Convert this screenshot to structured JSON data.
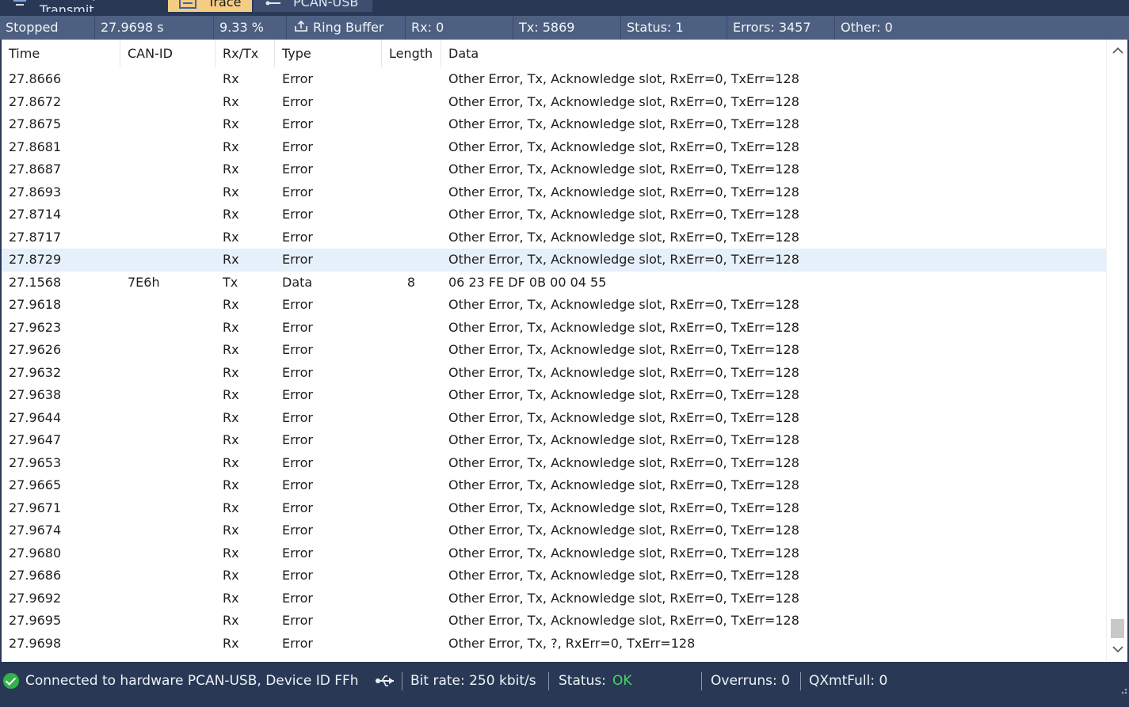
{
  "tabs": [
    {
      "label": "Receive / Transmit",
      "icon": "receive-transmit-icon"
    },
    {
      "label": "Trace",
      "icon": "trace-icon"
    },
    {
      "label": "PCAN-USB",
      "icon": "usb-icon"
    }
  ],
  "trace_status": {
    "state": "Stopped",
    "time": "27.9698 s",
    "buffer_percent": "9.33 %",
    "buffer_mode": "Ring Buffer",
    "rx": "Rx: 0",
    "tx": "Tx: 5869",
    "status": "Status: 1",
    "errors": "Errors: 3457",
    "other": "Other: 0"
  },
  "columns": [
    "Time",
    "CAN-ID",
    "Rx/Tx",
    "Type",
    "Length",
    "Data"
  ],
  "rows": [
    {
      "time": "27.8666",
      "id": "",
      "dir": "Rx",
      "type": "Error",
      "len": "",
      "data": "Other Error, Tx, Acknowledge slot, RxErr=0, TxErr=128"
    },
    {
      "time": "27.8672",
      "id": "",
      "dir": "Rx",
      "type": "Error",
      "len": "",
      "data": "Other Error, Tx, Acknowledge slot, RxErr=0, TxErr=128"
    },
    {
      "time": "27.8675",
      "id": "",
      "dir": "Rx",
      "type": "Error",
      "len": "",
      "data": "Other Error, Tx, Acknowledge slot, RxErr=0, TxErr=128"
    },
    {
      "time": "27.8681",
      "id": "",
      "dir": "Rx",
      "type": "Error",
      "len": "",
      "data": "Other Error, Tx, Acknowledge slot, RxErr=0, TxErr=128"
    },
    {
      "time": "27.8687",
      "id": "",
      "dir": "Rx",
      "type": "Error",
      "len": "",
      "data": "Other Error, Tx, Acknowledge slot, RxErr=0, TxErr=128"
    },
    {
      "time": "27.8693",
      "id": "",
      "dir": "Rx",
      "type": "Error",
      "len": "",
      "data": "Other Error, Tx, Acknowledge slot, RxErr=0, TxErr=128"
    },
    {
      "time": "27.8714",
      "id": "",
      "dir": "Rx",
      "type": "Error",
      "len": "",
      "data": "Other Error, Tx, Acknowledge slot, RxErr=0, TxErr=128"
    },
    {
      "time": "27.8717",
      "id": "",
      "dir": "Rx",
      "type": "Error",
      "len": "",
      "data": "Other Error, Tx, Acknowledge slot, RxErr=0, TxErr=128"
    },
    {
      "time": "27.8729",
      "id": "",
      "dir": "Rx",
      "type": "Error",
      "len": "",
      "data": "Other Error, Tx, Acknowledge slot, RxErr=0, TxErr=128",
      "selected": true
    },
    {
      "time": "27.1568",
      "id": "7E6h",
      "dir": "Tx",
      "type": "Data",
      "len": "8",
      "data": "06 23 FE DF 0B 00 04 55"
    },
    {
      "time": "27.9618",
      "id": "",
      "dir": "Rx",
      "type": "Error",
      "len": "",
      "data": "Other Error, Tx, Acknowledge slot, RxErr=0, TxErr=128"
    },
    {
      "time": "27.9623",
      "id": "",
      "dir": "Rx",
      "type": "Error",
      "len": "",
      "data": "Other Error, Tx, Acknowledge slot, RxErr=0, TxErr=128"
    },
    {
      "time": "27.9626",
      "id": "",
      "dir": "Rx",
      "type": "Error",
      "len": "",
      "data": "Other Error, Tx, Acknowledge slot, RxErr=0, TxErr=128"
    },
    {
      "time": "27.9632",
      "id": "",
      "dir": "Rx",
      "type": "Error",
      "len": "",
      "data": "Other Error, Tx, Acknowledge slot, RxErr=0, TxErr=128"
    },
    {
      "time": "27.9638",
      "id": "",
      "dir": "Rx",
      "type": "Error",
      "len": "",
      "data": "Other Error, Tx, Acknowledge slot, RxErr=0, TxErr=128"
    },
    {
      "time": "27.9644",
      "id": "",
      "dir": "Rx",
      "type": "Error",
      "len": "",
      "data": "Other Error, Tx, Acknowledge slot, RxErr=0, TxErr=128"
    },
    {
      "time": "27.9647",
      "id": "",
      "dir": "Rx",
      "type": "Error",
      "len": "",
      "data": "Other Error, Tx, Acknowledge slot, RxErr=0, TxErr=128"
    },
    {
      "time": "27.9653",
      "id": "",
      "dir": "Rx",
      "type": "Error",
      "len": "",
      "data": "Other Error, Tx, Acknowledge slot, RxErr=0, TxErr=128"
    },
    {
      "time": "27.9665",
      "id": "",
      "dir": "Rx",
      "type": "Error",
      "len": "",
      "data": "Other Error, Tx, Acknowledge slot, RxErr=0, TxErr=128"
    },
    {
      "time": "27.9671",
      "id": "",
      "dir": "Rx",
      "type": "Error",
      "len": "",
      "data": "Other Error, Tx, Acknowledge slot, RxErr=0, TxErr=128"
    },
    {
      "time": "27.9674",
      "id": "",
      "dir": "Rx",
      "type": "Error",
      "len": "",
      "data": "Other Error, Tx, Acknowledge slot, RxErr=0, TxErr=128"
    },
    {
      "time": "27.9680",
      "id": "",
      "dir": "Rx",
      "type": "Error",
      "len": "",
      "data": "Other Error, Tx, Acknowledge slot, RxErr=0, TxErr=128"
    },
    {
      "time": "27.9686",
      "id": "",
      "dir": "Rx",
      "type": "Error",
      "len": "",
      "data": "Other Error, Tx, Acknowledge slot, RxErr=0, TxErr=128"
    },
    {
      "time": "27.9692",
      "id": "",
      "dir": "Rx",
      "type": "Error",
      "len": "",
      "data": "Other Error, Tx, Acknowledge slot, RxErr=0, TxErr=128"
    },
    {
      "time": "27.9695",
      "id": "",
      "dir": "Rx",
      "type": "Error",
      "len": "",
      "data": "Other Error, Tx, Acknowledge slot, RxErr=0, TxErr=128"
    },
    {
      "time": "27.9698",
      "id": "",
      "dir": "Rx",
      "type": "Error",
      "len": "",
      "data": "Other Error, Tx, ?, RxErr=0, TxErr=128"
    }
  ],
  "statusbar": {
    "connection": "Connected to hardware PCAN-USB, Device ID FFh",
    "bitrate": "Bit rate: 250 kbit/s",
    "status_label": "Status:",
    "status_value": "OK",
    "overruns": "Overruns: 0",
    "qxmtfull": "QXmtFull: 0"
  },
  "colors": {
    "accent_tab": "#f5cc84",
    "chrome": "#293955",
    "strip": "#4d6082",
    "ok": "#48d36a",
    "selected_row": "#e6f0fa"
  }
}
